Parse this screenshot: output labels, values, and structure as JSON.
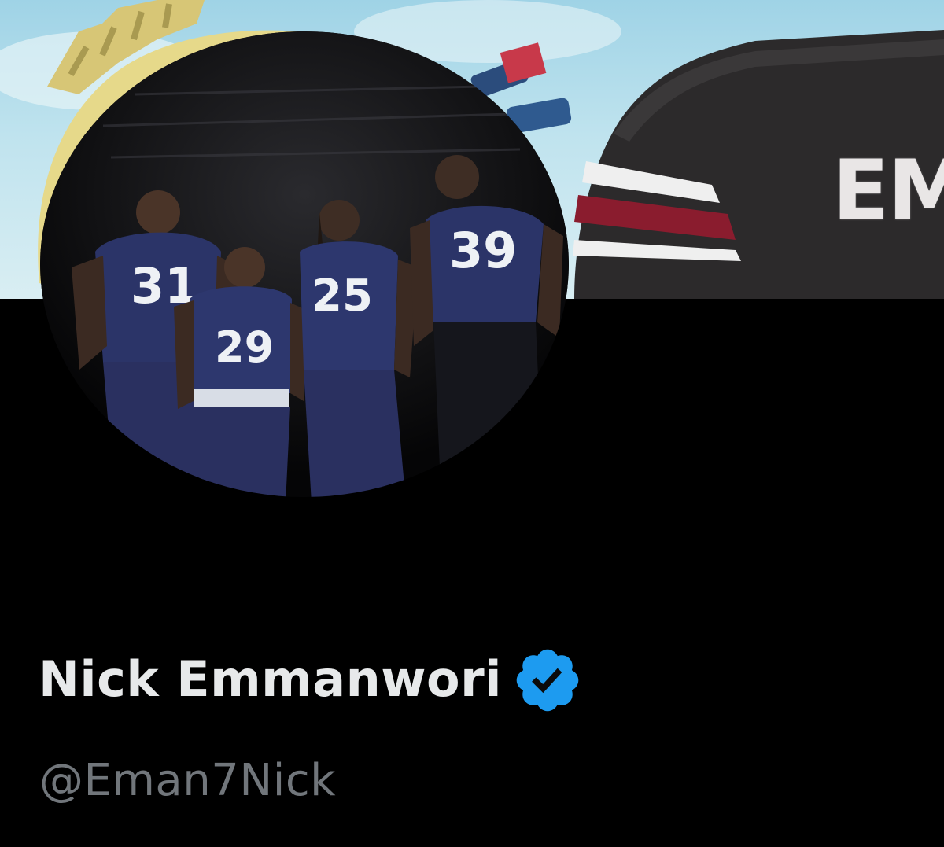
{
  "profile": {
    "display_name": "Nick Emmanwori",
    "handle": "@Eman7Nick",
    "verified": true
  },
  "banner": {
    "jersey_lettering": "EM"
  },
  "avatar": {
    "jersey_numbers": [
      "31",
      "29",
      "25",
      "39"
    ]
  },
  "colors": {
    "background": "#000000",
    "name_text": "#e7e9ea",
    "handle_text": "#71767b",
    "verified_blue": "#1d9bf0"
  },
  "icons": {
    "verified": "verified-badge-icon"
  }
}
